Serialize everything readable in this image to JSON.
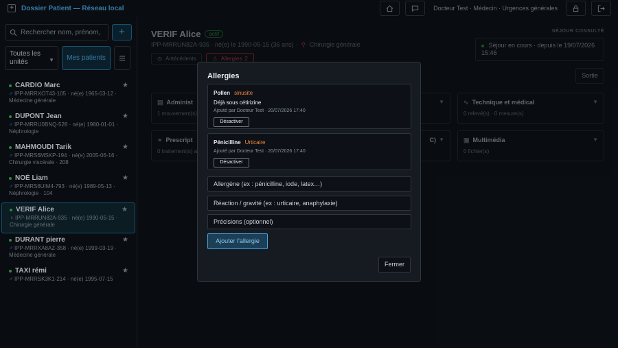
{
  "topbar": {
    "brand": "Dossier Patient — Réseau local",
    "user": "Docteur Test · Médecin · Urgences générales",
    "icons": [
      "home-icon",
      "message-icon",
      "lock-icon",
      "logout-icon"
    ]
  },
  "sidebar": {
    "search_placeholder": "Rechercher nom, prénom, IPI",
    "add_label": "+",
    "filter_service": "Toutes les unités",
    "mine_label": "Mes patients",
    "patients": [
      {
        "name": "CARDIO Marc",
        "meta1": "IPP-MRRXOT43-105 · né(e) 1965-03-12 ·",
        "meta2": "Médecine générale",
        "gender": "m",
        "active": false
      },
      {
        "name": "DUPONT Jean",
        "meta1": "IPP-MRRU0BNQ-528 · né(e) 1980-01-01 ·",
        "meta2": "Néphrologie",
        "gender": "m",
        "active": false
      },
      {
        "name": "MAHMOUDI Tarik",
        "meta1": "IPP-MRS6MSKP-194 · né(e) 2005-06-16 ·",
        "meta2": "Chirurgie viscérale · 208",
        "gender": "m",
        "active": false
      },
      {
        "name": "NOÉ Liam",
        "meta1": "IPP-MRS6UIM4-793 · né(e) 1989-05-13 ·",
        "meta2": "Néphrologie · 104",
        "gender": "m",
        "active": false
      },
      {
        "name": "VERIF Alice",
        "meta1": "IPP-MRRUN82A-935 · né(e) 1990-05-15 ·",
        "meta2": "Chirurgie générale",
        "gender": "f",
        "active": true
      },
      {
        "name": "DURANT pierre",
        "meta1": "IPP-MRRXA8AZ-358 · né(e) 1999-03-19 ·",
        "meta2": "Médecine générale",
        "gender": "m",
        "active": false
      },
      {
        "name": "TAXI rémi",
        "meta1": "IPP-MRRSK3K1-214 · né(e) 1995-07-15",
        "meta2": "",
        "gender": "m",
        "active": false
      }
    ]
  },
  "main": {
    "patient_name": "VERIF Alice",
    "status_badge": "actif",
    "sub_left": "IPP-MRRUN82A-935 · né(e) le 1990-05-15 (36 ans) ·",
    "sub_service": "Chirurgie générale",
    "tab_antecedents": "Antécédents",
    "tab_allergies": "Allergies",
    "tab_allergies_count": "2",
    "sejour_label": "SÉJOUR CONSULTÉ",
    "sejour_value": "Séjour en cours · depuis le 19/07/2026 15:46",
    "sortie_label": "Sortie",
    "cards": [
      {
        "title": "Administ",
        "sub": "1 mouvement(s)"
      },
      {
        "title": "Prescript",
        "sub": "0 traitement(s) a"
      },
      {
        "title": "Technique et médical",
        "sub": "0 relevé(s) · 0 mesure(s)"
      },
      {
        "title": "Multimédia",
        "sub": "0 fichier(s)"
      },
      {
        "title": "C)",
        "sub": ""
      }
    ]
  },
  "modal": {
    "title": "Allergies",
    "allergies": [
      {
        "name": "Pollen",
        "reaction": "sinusite",
        "detail": "Déjà sous cétirizine",
        "added_by": "Ajouté par Docteur Test · 20/07/2026 17:40",
        "action": "Désactiver"
      },
      {
        "name": "Pénicilline",
        "reaction": "Urticaire",
        "detail": "",
        "added_by": "Ajouté par Docteur Test · 20/07/2026 17:40",
        "action": "Désactiver"
      }
    ],
    "input_allergen_placeholder": "Allergène (ex : pénicilline, iode, latex…)",
    "input_reaction_placeholder": "Réaction / gravité (ex : urticaire, anaphylaxie)",
    "input_details_placeholder": "Précisions (optionnel)",
    "add_label": "Ajouter l'allergie",
    "close_label": "Fermer"
  },
  "colors": {
    "accent": "#4aa3df",
    "warn": "#f85149",
    "reaction": "#f0883e",
    "active_dot": "#3fb950"
  }
}
